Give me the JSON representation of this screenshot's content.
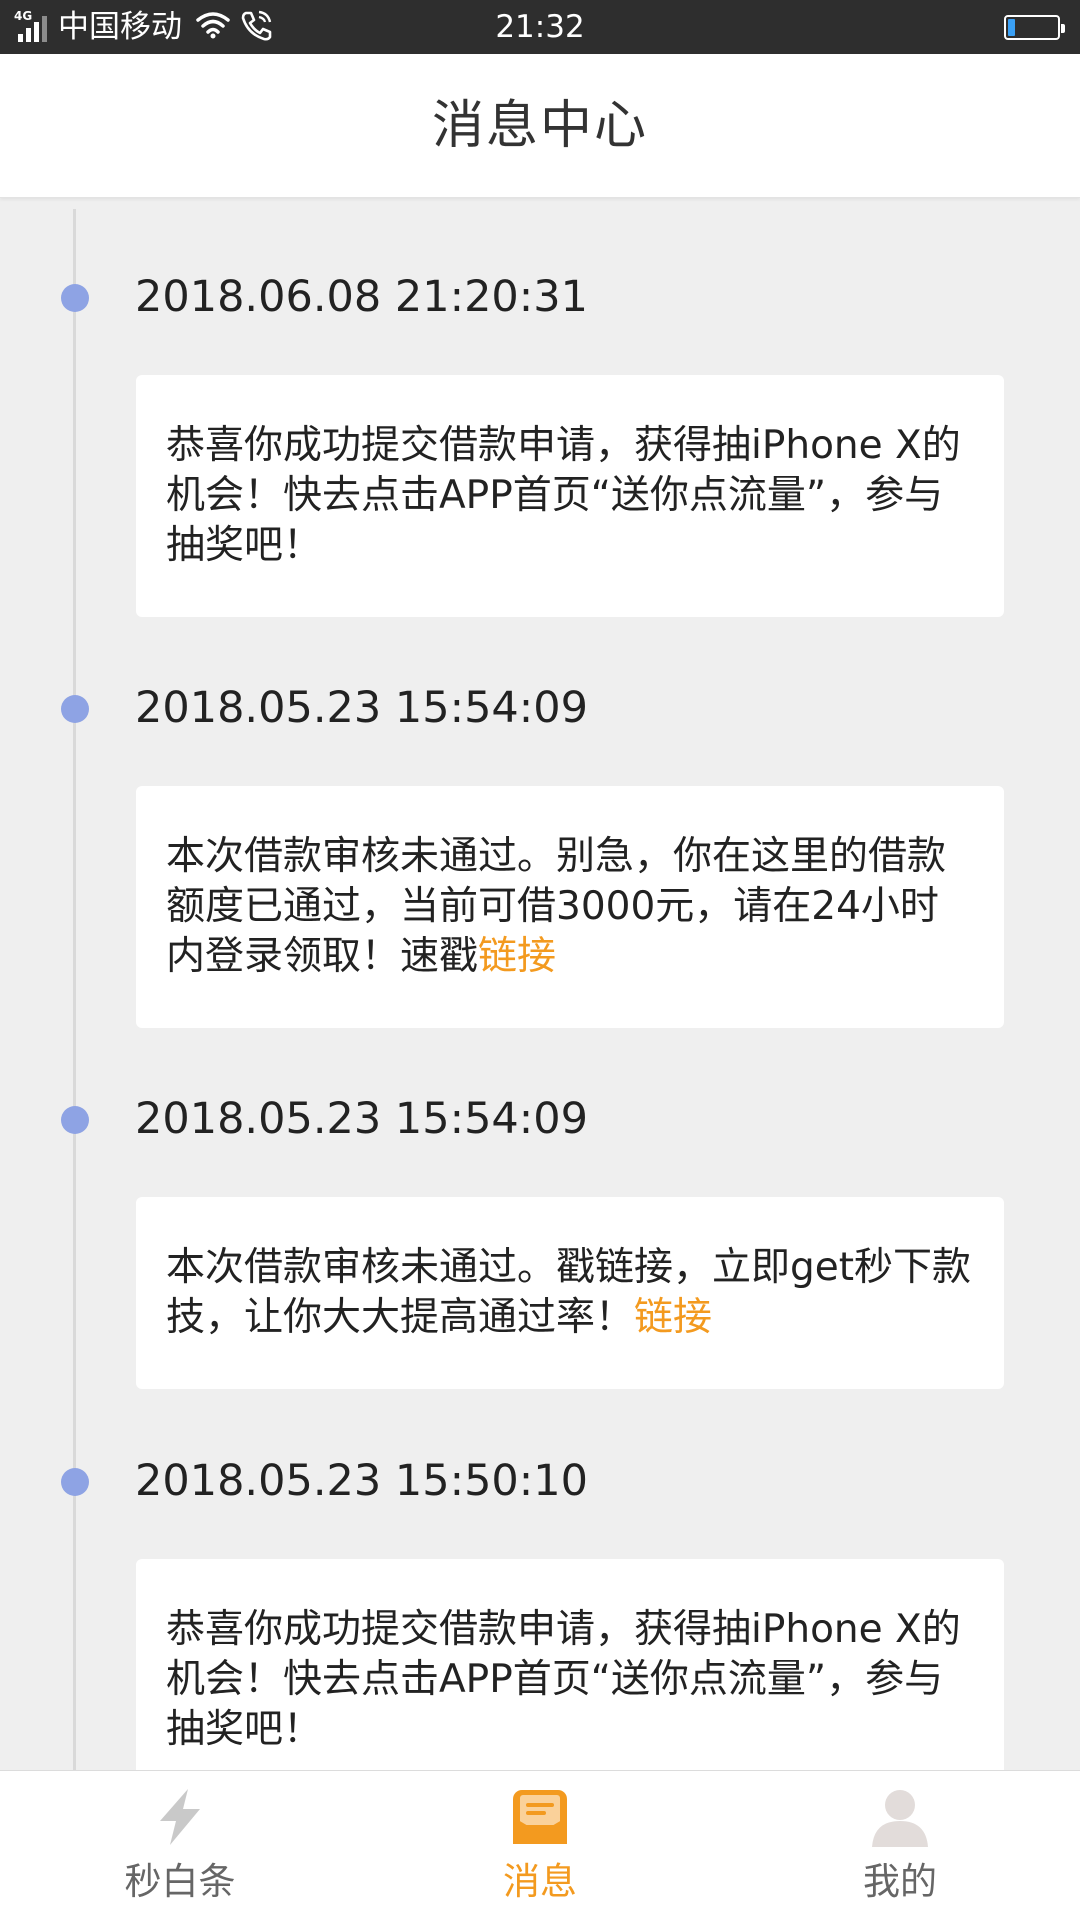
{
  "status_bar": {
    "network": "4G",
    "carrier": "中国移动",
    "time": "21:32",
    "battery_percent": 15
  },
  "header": {
    "title": "消息中心"
  },
  "messages": [
    {
      "timestamp": "2018.06.08 21:20:31",
      "text": "恭喜你成功提交借款申请，获得抽iPhone X的机会！快去点击APP首页“送你点流量”，参与抽奖吧！",
      "link": ""
    },
    {
      "timestamp": "2018.05.23 15:54:09",
      "text": "本次借款审核未通过。别急，你在这里的借款额度已通过，当前可借3000元，请在24小时内登录领取！速戳",
      "link": "链接"
    },
    {
      "timestamp": "2018.05.23 15:54:09",
      "text": "本次借款审核未通过。戳链接，立即get秒下款技，让你大大提高通过率！",
      "link": "链接"
    },
    {
      "timestamp": "2018.05.23 15:50:10",
      "text": "恭喜你成功提交借款申请，获得抽iPhone X的机会！快去点击APP首页“送你点流量”，参与抽奖吧！",
      "link": ""
    }
  ],
  "bottom_nav": {
    "items": [
      {
        "label": "秒白条",
        "icon": "lightning-icon",
        "active": false
      },
      {
        "label": "消息",
        "icon": "message-icon",
        "active": true
      },
      {
        "label": "我的",
        "icon": "profile-icon",
        "active": false
      }
    ]
  },
  "colors": {
    "accent": "#f39a1f",
    "timeline_dot": "#8ea3e4",
    "background": "#efefef",
    "status_bar": "#2e2e2e"
  }
}
